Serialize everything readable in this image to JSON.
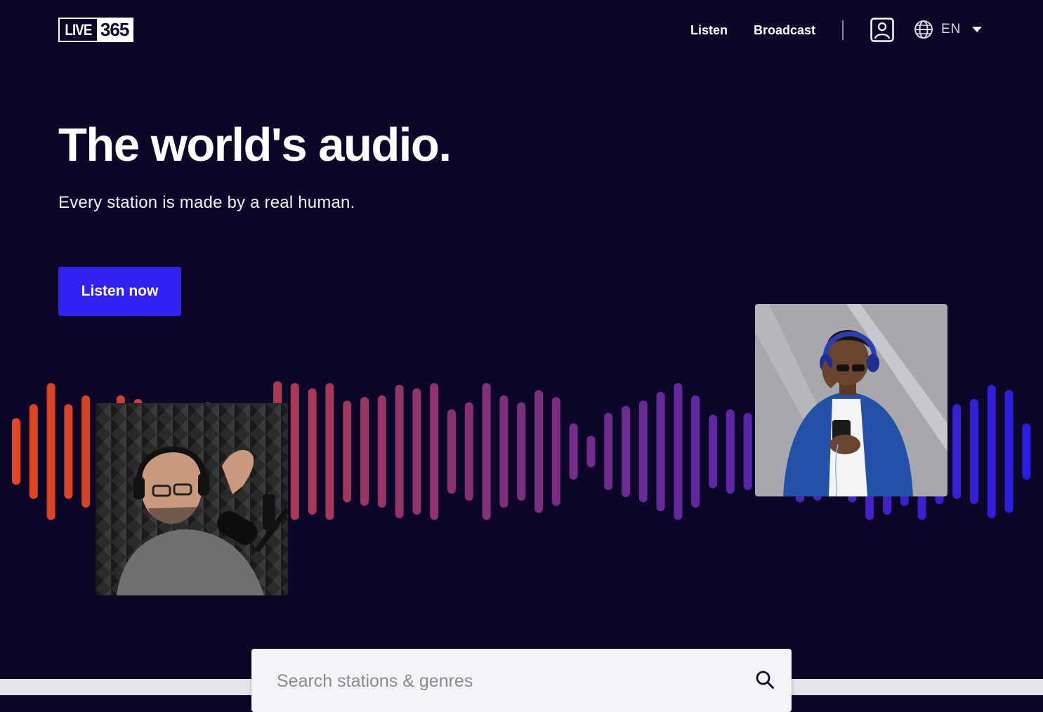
{
  "header": {
    "logo": {
      "part1": "LIVE",
      "part2": "365"
    },
    "nav": {
      "listen": "Listen",
      "broadcast": "Broadcast"
    },
    "account_icon": "user-icon",
    "language": {
      "icon": "globe-icon",
      "code": "EN"
    }
  },
  "hero": {
    "title": "The world's audio.",
    "subtitle": "Every station is made by a real human.",
    "cta_label": "Listen now"
  },
  "search": {
    "placeholder": "Search stations & genres",
    "icon": "search-icon"
  },
  "colors": {
    "background": "#0c0628",
    "cta": "#3320f3",
    "wave_start": "#e0461f",
    "wave_mid": "#7c2f7e",
    "wave_end": "#2c1ce0"
  }
}
